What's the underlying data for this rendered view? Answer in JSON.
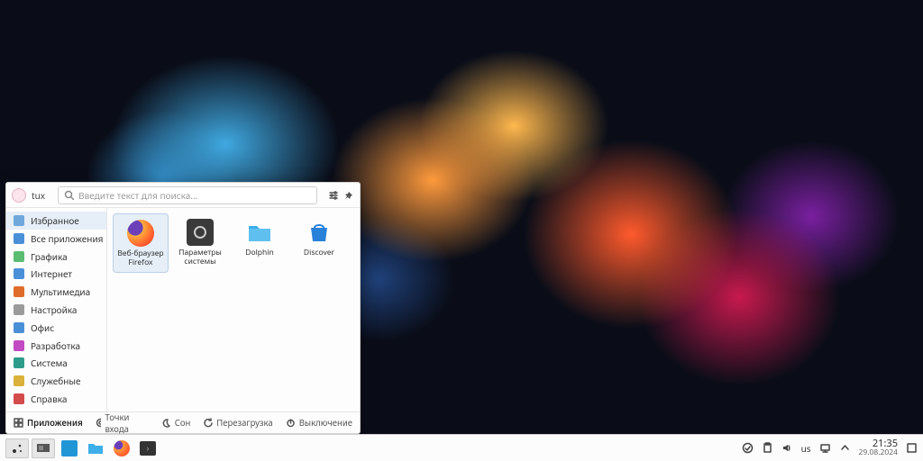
{
  "user": "tux",
  "search": {
    "placeholder": "Введите текст для поиска…"
  },
  "categories": [
    {
      "label": "Избранное",
      "color": "#6fa8dc",
      "selected": true
    },
    {
      "label": "Все приложения",
      "color": "#4a90d9"
    },
    {
      "label": "Графика",
      "color": "#5bbd72"
    },
    {
      "label": "Интернет",
      "color": "#4a90d9"
    },
    {
      "label": "Мультимедиа",
      "color": "#e06c2b"
    },
    {
      "label": "Настройка",
      "color": "#9b9b9b"
    },
    {
      "label": "Офис",
      "color": "#4a90d9"
    },
    {
      "label": "Разработка",
      "color": "#c24ac2"
    },
    {
      "label": "Система",
      "color": "#2d9c8a"
    },
    {
      "label": "Служебные",
      "color": "#d9b13b"
    },
    {
      "label": "Справка",
      "color": "#d34b4b"
    }
  ],
  "apps": [
    {
      "label": "Веб-браузер Firefox",
      "selected": true,
      "ico": "firefox"
    },
    {
      "label": "Параметры системы",
      "ico": "settings"
    },
    {
      "label": "Dolphin",
      "ico": "folder"
    },
    {
      "label": "Discover",
      "ico": "store"
    }
  ],
  "footer": {
    "tab_apps": "Приложения",
    "tab_places": "Точки входа",
    "sleep": "Сон",
    "reboot": "Перезагрузка",
    "shutdown": "Выключение"
  },
  "tray": {
    "keyboard": "us",
    "time": "21:35",
    "date": "29.08.2024"
  }
}
